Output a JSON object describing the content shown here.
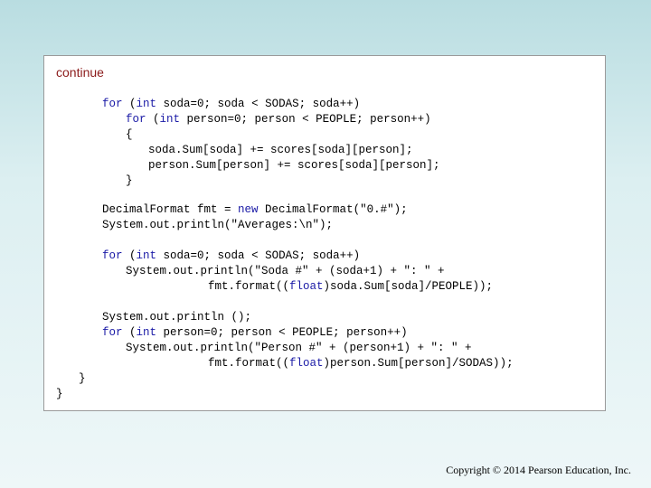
{
  "slide": {
    "continue_label": "continue",
    "code_lines": [
      {
        "segs": [
          [
            "for",
            "kw"
          ],
          [
            " (",
            ""
          ],
          [
            "int",
            "kw"
          ],
          [
            " soda=0; soda < SODAS; soda++)",
            ""
          ]
        ]
      },
      {
        "segs": [
          [
            "for",
            "kw"
          ],
          [
            " (",
            ""
          ],
          [
            "int",
            "kw"
          ],
          [
            " person=0; person < PEOPLE; person++)",
            ""
          ]
        ]
      },
      {
        "segs": [
          [
            "{",
            ""
          ]
        ]
      },
      {
        "segs": [
          [
            "soda.Sum[soda] += scores[soda][person];",
            ""
          ]
        ]
      },
      {
        "segs": [
          [
            "person.Sum[person] += scores[soda][person];",
            ""
          ]
        ]
      },
      {
        "segs": [
          [
            "}",
            ""
          ]
        ]
      },
      {
        "segs": [
          [
            "DecimalFormat fmt = ",
            ""
          ],
          [
            "new",
            "kw"
          ],
          [
            " DecimalFormat(\"0.#\");",
            ""
          ]
        ]
      },
      {
        "segs": [
          [
            "System.out.println(\"Averages:\\n\");",
            ""
          ]
        ]
      },
      {
        "segs": [
          [
            "for",
            "kw"
          ],
          [
            " (",
            ""
          ],
          [
            "int",
            "kw"
          ],
          [
            " soda=0; soda < SODAS; soda++)",
            ""
          ]
        ]
      },
      {
        "segs": [
          [
            "System.out.println(\"Soda #\" + (soda+1) + \": \" +",
            ""
          ]
        ]
      },
      {
        "segs": [
          [
            "fmt.format((",
            ""
          ],
          [
            "float",
            "kw"
          ],
          [
            ")soda.Sum[soda]/PEOPLE));",
            ""
          ]
        ]
      },
      {
        "segs": [
          [
            "System.out.println ();",
            ""
          ]
        ]
      },
      {
        "segs": [
          [
            "for",
            "kw"
          ],
          [
            " (",
            ""
          ],
          [
            "int",
            "kw"
          ],
          [
            " person=0; person < PEOPLE; person++)",
            ""
          ]
        ]
      },
      {
        "segs": [
          [
            "System.out.println(\"Person #\" + (person+1) + \": \" +",
            ""
          ]
        ]
      },
      {
        "segs": [
          [
            "fmt.format((",
            ""
          ],
          [
            "float",
            "kw"
          ],
          [
            ")person.Sum[person]/SODAS));",
            ""
          ]
        ]
      },
      {
        "segs": [
          [
            "}",
            ""
          ]
        ]
      },
      {
        "segs": [
          [
            "}",
            ""
          ]
        ]
      }
    ]
  },
  "footer": {
    "copyright": "Copyright © 2014 Pearson Education, Inc."
  }
}
